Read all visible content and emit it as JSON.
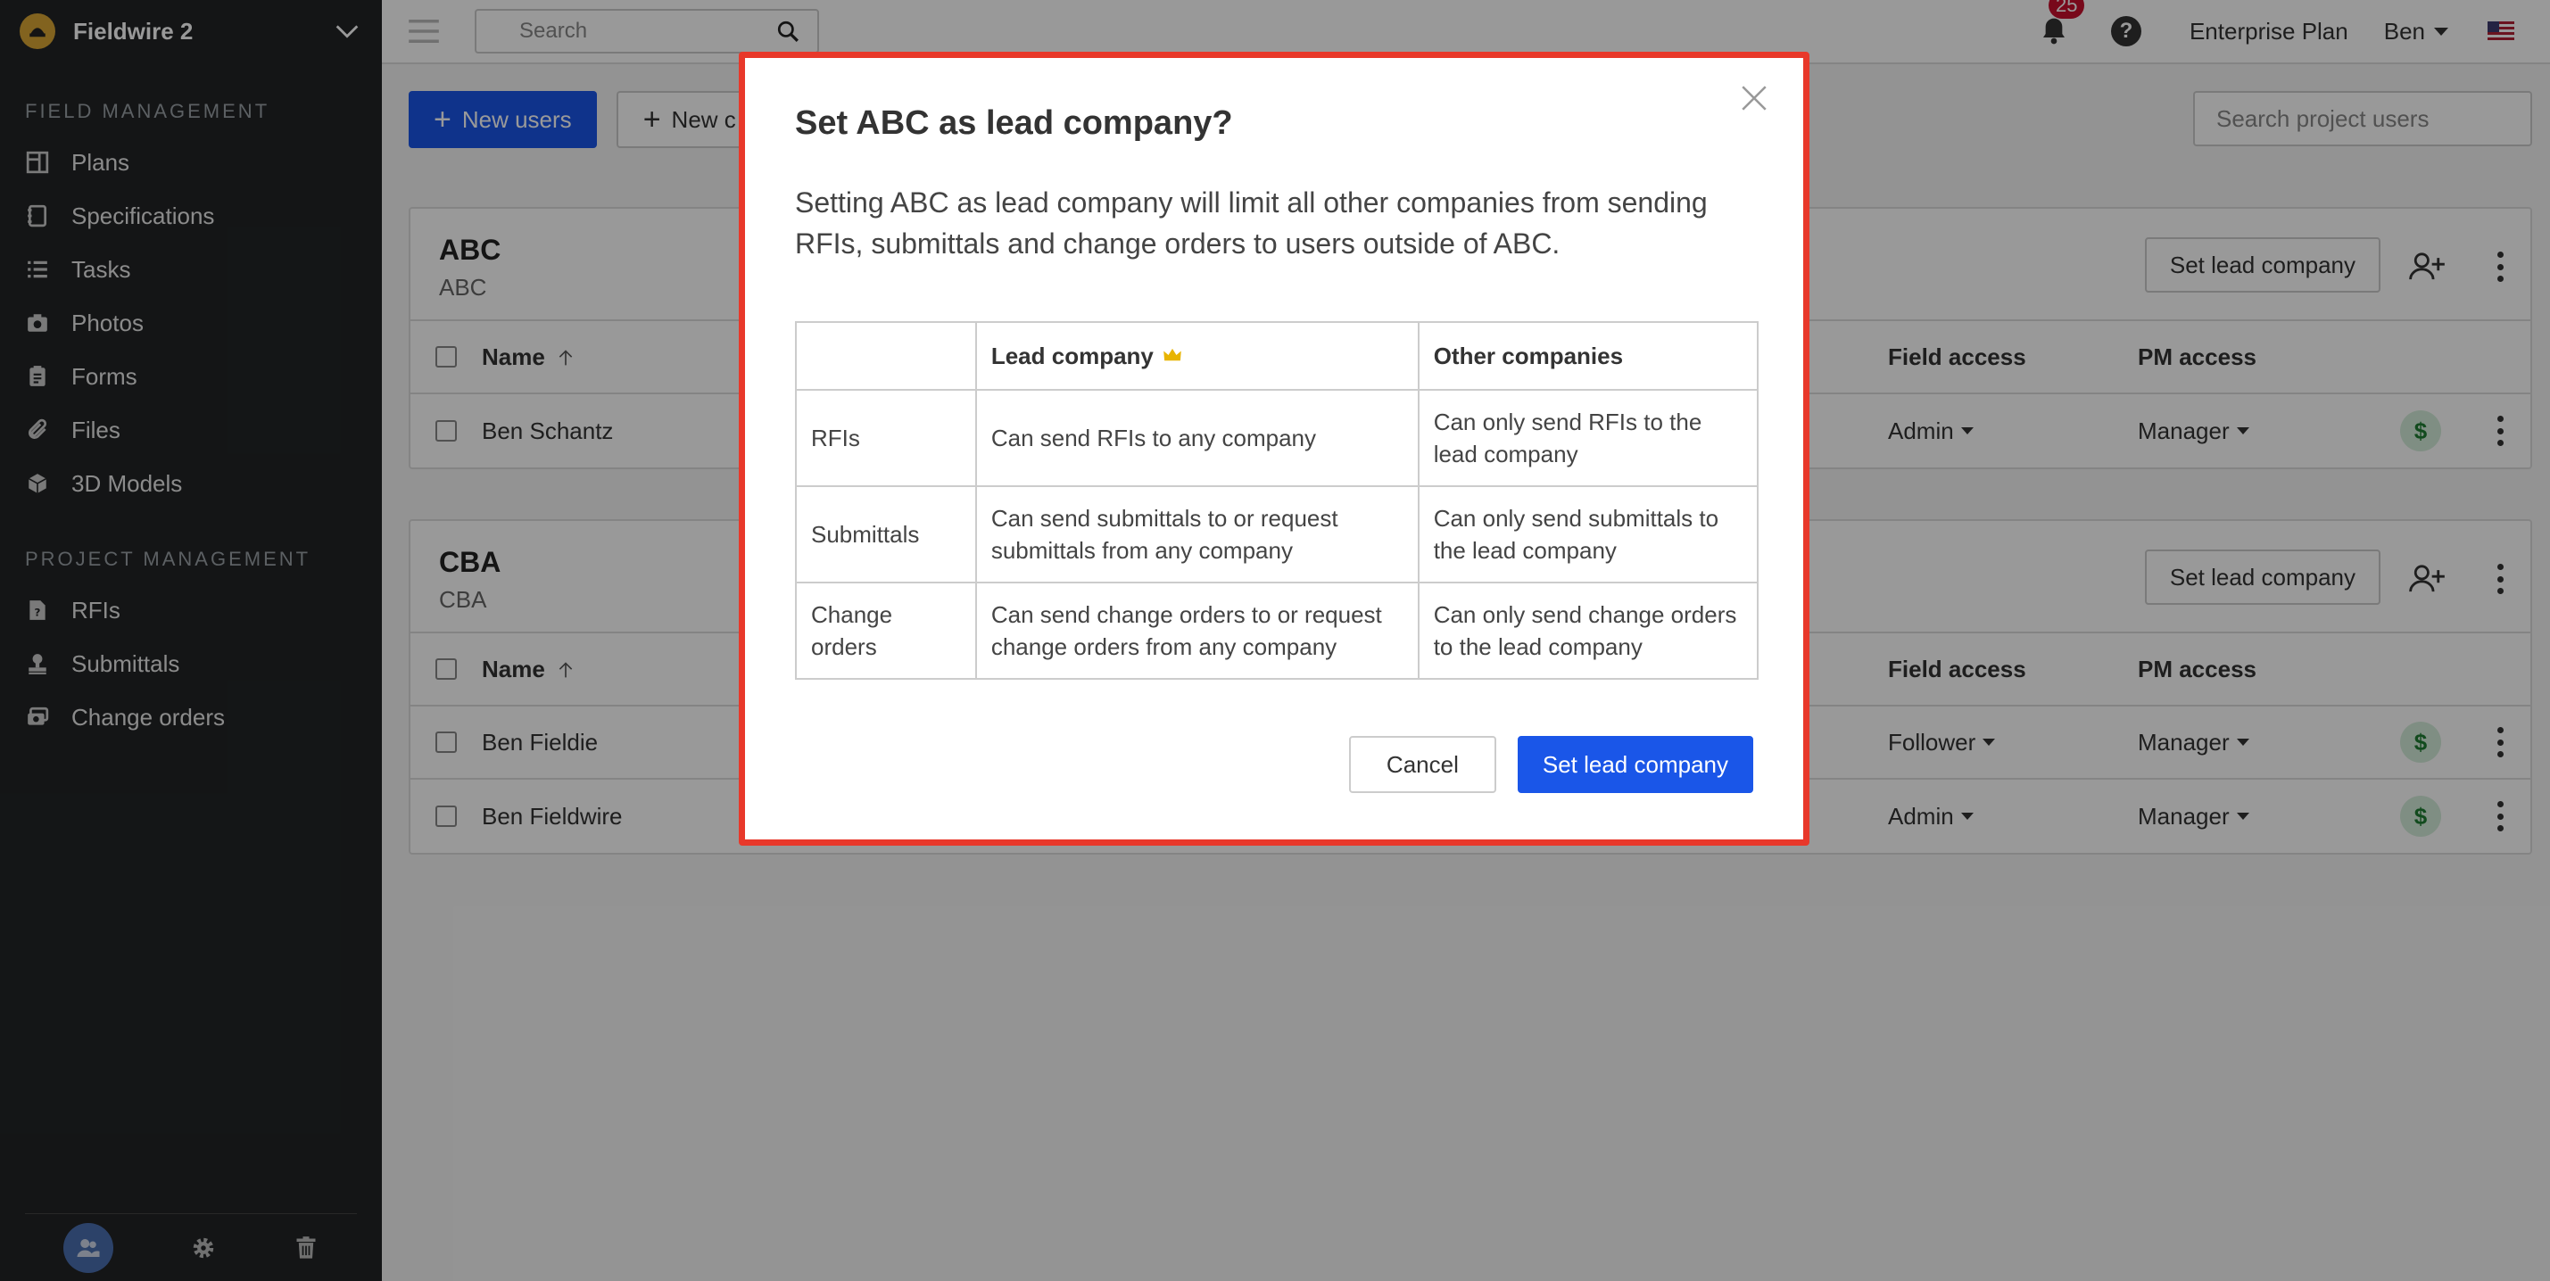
{
  "sidebar": {
    "project_name": "Fieldwire 2",
    "field_section": "FIELD MANAGEMENT",
    "field_items": [
      {
        "label": "Plans"
      },
      {
        "label": "Specifications"
      },
      {
        "label": "Tasks"
      },
      {
        "label": "Photos"
      },
      {
        "label": "Forms"
      },
      {
        "label": "Files"
      },
      {
        "label": "3D Models"
      }
    ],
    "pm_section": "PROJECT MANAGEMENT",
    "pm_items": [
      {
        "label": "RFIs"
      },
      {
        "label": "Submittals"
      },
      {
        "label": "Change orders"
      }
    ]
  },
  "topbar": {
    "search_placeholder": "Search",
    "notifications": "25",
    "plan": "Enterprise Plan",
    "user": "Ben"
  },
  "toolbar": {
    "new_users": "New users",
    "new_company": "New c",
    "search_users_placeholder": "Search project users"
  },
  "companies": [
    {
      "name": "ABC",
      "sub": "ABC",
      "set_lead": "Set lead company",
      "headers": {
        "name": "Name",
        "field_access": "Field access",
        "pm_access": "PM access"
      },
      "users": [
        {
          "name": "Ben Schantz",
          "field_access": "Admin",
          "pm_access": "Manager"
        }
      ]
    },
    {
      "name": "CBA",
      "sub": "CBA",
      "set_lead": "Set lead company",
      "headers": {
        "name": "Name",
        "field_access": "Field access",
        "pm_access": "PM access"
      },
      "users": [
        {
          "name": "Ben Fieldie",
          "field_access": "Follower",
          "pm_access": "Manager"
        },
        {
          "name": "Ben Fieldwire",
          "field_access": "Admin",
          "pm_access": "Manager"
        }
      ]
    }
  ],
  "modal": {
    "title": "Set ABC as lead company?",
    "body": "Setting ABC as lead company will limit all other companies from sending RFIs, submittals and change orders to users outside of ABC.",
    "table": {
      "headers": [
        "",
        "Lead company",
        "Other companies"
      ],
      "rows": [
        {
          "label": "RFIs",
          "lead": "Can send RFIs to any company",
          "other": "Can only send RFIs to the lead company"
        },
        {
          "label": "Submittals",
          "lead": "Can send submittals to or request submittals from any company",
          "other": "Can only send submittals to the lead company"
        },
        {
          "label": "Change orders",
          "lead": "Can send change orders to or request change orders from any company",
          "other": "Can only send change orders to the lead company"
        }
      ]
    },
    "cancel": "Cancel",
    "confirm": "Set lead company"
  },
  "colors": {
    "primary": "#1a56e8",
    "highlight_border": "#e8382a",
    "sidebar_bg": "#222426",
    "crown": "#e8b400"
  }
}
